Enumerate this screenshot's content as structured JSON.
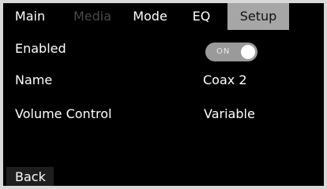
{
  "tabs": {
    "main": "Main",
    "media": "Media",
    "mode": "Mode",
    "eq": "EQ",
    "setup": "Setup"
  },
  "settings": {
    "enabled": {
      "label": "Enabled",
      "toggle_text": "ON"
    },
    "name": {
      "label": "Name",
      "value": "Coax 2"
    },
    "volume_control": {
      "label": "Volume Control",
      "value": "Variable"
    }
  },
  "footer": {
    "back_label": "Back"
  },
  "colors": {
    "background": "#000000",
    "active_tab": "#a6a6a6",
    "disabled_tab_text": "#4a4a4a",
    "toggle_track": "#9a9a9a"
  }
}
